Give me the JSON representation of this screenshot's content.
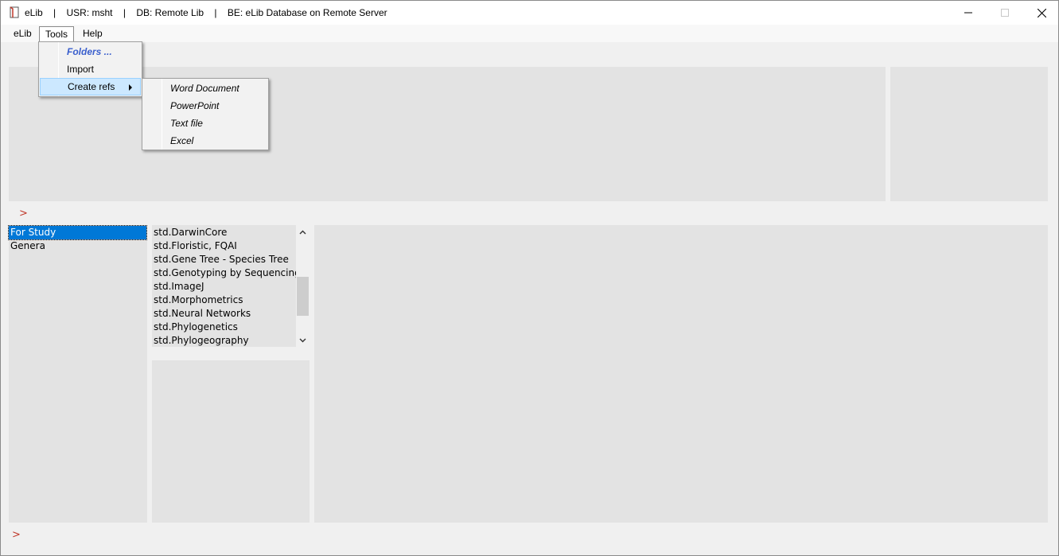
{
  "titlebar": {
    "app_name": "eLib",
    "separator": "|",
    "user": "USR: msht",
    "db": "DB: Remote Lib",
    "backend": "BE: eLib Database on Remote Server"
  },
  "menubar": {
    "items": [
      {
        "label": "eLib"
      },
      {
        "label": "Tools"
      },
      {
        "label": "Help"
      }
    ]
  },
  "tools_menu": {
    "items": [
      {
        "label": "Folders ..."
      },
      {
        "label": "Import"
      },
      {
        "label": "Create refs"
      }
    ]
  },
  "create_refs_submenu": {
    "items": [
      {
        "label": "Word Document"
      },
      {
        "label": "PowerPoint"
      },
      {
        "label": "Text file"
      },
      {
        "label": "Excel"
      }
    ]
  },
  "prompts": {
    "upper": ">",
    "lower": ">"
  },
  "folder_list": {
    "items": [
      {
        "label": "For Study",
        "selected": true
      },
      {
        "label": "Genera",
        "selected": false
      }
    ]
  },
  "template_list": {
    "items": [
      {
        "label": "std.DarwinCore"
      },
      {
        "label": "std.Floristic, FQAI"
      },
      {
        "label": "std.Gene Tree - Species Tree"
      },
      {
        "label": "std.Genotyping by Sequencing"
      },
      {
        "label": "std.ImageJ"
      },
      {
        "label": "std.Morphometrics"
      },
      {
        "label": "std.Neural Networks"
      },
      {
        "label": "std.Phylogenetics"
      },
      {
        "label": "std.Phylogeography"
      }
    ]
  },
  "colors": {
    "selection": "#0078d7",
    "prompt": "#c0392b",
    "folders_link": "#3a5fcd",
    "menu_highlight": "#cce8ff"
  }
}
